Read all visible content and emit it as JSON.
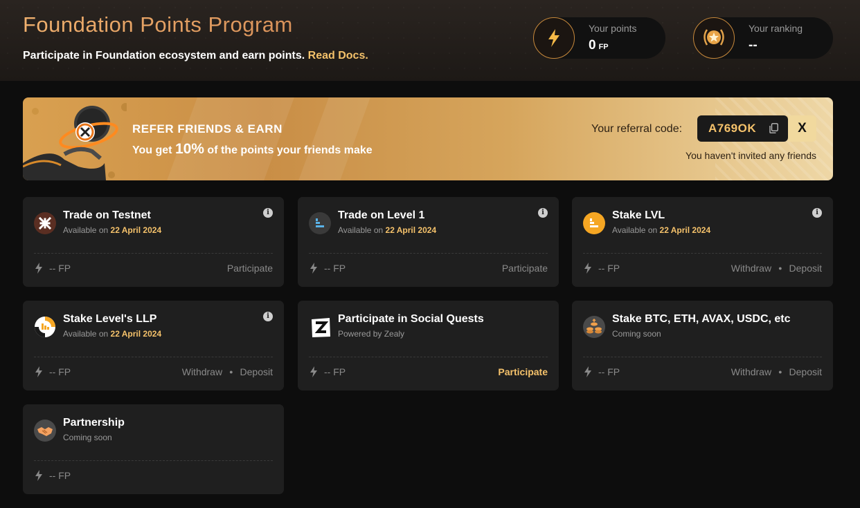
{
  "header": {
    "title": "Foundation Points Program",
    "subtitle": "Participate in Foundation ecosystem and earn points.",
    "docs_link": "Read Docs."
  },
  "stats": {
    "points_label": "Your points",
    "points_value": "0",
    "points_unit": "FP",
    "ranking_label": "Your ranking",
    "ranking_value": "--"
  },
  "banner": {
    "title": "REFER FRIENDS & EARN",
    "sub_prefix": "You get",
    "sub_percent": "10%",
    "sub_suffix": "of the points your friends make",
    "ref_label": "Your referral code:",
    "ref_code": "A769OK",
    "share_label": "X",
    "no_invites": "You haven't invited any friends"
  },
  "colors": {
    "accent": "#f5c26b",
    "card_bg": "#1f1f1f",
    "page_bg": "#0d0d0d"
  },
  "tasks": [
    {
      "title": "Trade on Testnet",
      "sub": "Available on",
      "date": "22 April 2024",
      "fp": "-- FP",
      "actions": [
        "Participate"
      ],
      "icon": "testnet-logo-icon",
      "info": "i"
    },
    {
      "title": "Trade on Level 1",
      "sub": "Available on",
      "date": "22 April 2024",
      "fp": "-- FP",
      "actions": [
        "Participate"
      ],
      "icon": "level-logo-icon",
      "info": "i"
    },
    {
      "title": "Stake LVL",
      "sub": "Available on",
      "date": "22 April 2024",
      "fp": "-- FP",
      "actions": [
        "Withdraw",
        "Deposit"
      ],
      "icon": "lvl-token-icon",
      "info": "i"
    },
    {
      "title": "Stake Level's LLP",
      "sub": "Available on",
      "date": "22 April 2024",
      "fp": "-- FP",
      "actions": [
        "Withdraw",
        "Deposit"
      ],
      "icon": "llp-token-icon",
      "info": "i"
    },
    {
      "title": "Participate in Social Quests",
      "sub": "Powered by Zealy",
      "date": "",
      "fp": "-- FP",
      "actions": [
        "Participate"
      ],
      "icon": "zealy-logo-icon"
    },
    {
      "title": "Stake BTC, ETH, AVAX, USDC, etc",
      "sub": "Coming soon",
      "date": "",
      "fp": "-- FP",
      "actions": [
        "Withdraw",
        "Deposit"
      ],
      "icon": "coins-stack-icon"
    },
    {
      "title": "Partnership",
      "sub": "Coming soon",
      "date": "",
      "fp": "-- FP",
      "actions": [],
      "icon": "handshake-icon"
    }
  ]
}
